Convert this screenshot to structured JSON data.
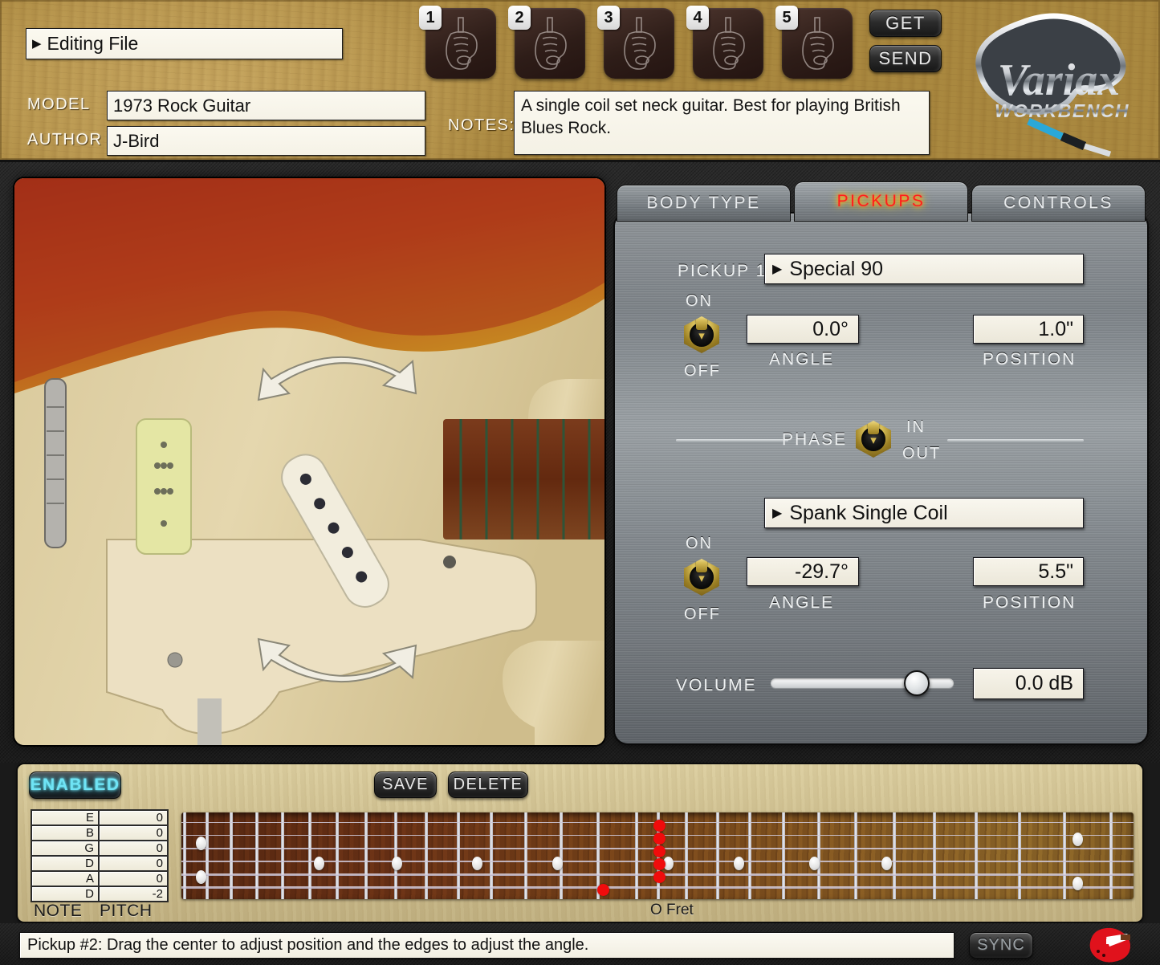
{
  "header": {
    "file_select": "Editing File",
    "model_label": "MODEL",
    "model_value": "1973 Rock Guitar",
    "author_label": "AUTHOR",
    "author_value": "J-Bird",
    "notes_label": "NOTES:",
    "notes_value": "A single coil set neck guitar.  Best for playing British Blues Rock.",
    "get_label": "GET",
    "send_label": "SEND",
    "presets": [
      "1",
      "2",
      "3",
      "4",
      "5"
    ],
    "logo_name": "Variax",
    "logo_sub": "WORKBENCH"
  },
  "tabs": [
    {
      "label": "BODY TYPE",
      "active": false
    },
    {
      "label": "PICKUPS",
      "active": true
    },
    {
      "label": "CONTROLS",
      "active": false
    }
  ],
  "pickups_panel": {
    "pickup1": {
      "row_label": "PICKUP 1",
      "model": "Special 90",
      "toggle_on": "ON",
      "toggle_off": "OFF",
      "angle_value": "0.0°",
      "angle_label": "ANGLE",
      "position_value": "1.0\"",
      "position_label": "POSITION"
    },
    "phase": {
      "label": "PHASE",
      "in_label": "IN",
      "out_label": "OUT"
    },
    "pickup2": {
      "model": "Spank Single Coil",
      "toggle_on": "ON",
      "toggle_off": "OFF",
      "angle_value": "-29.7°",
      "angle_label": "ANGLE",
      "position_value": "5.5\"",
      "position_label": "POSITION"
    },
    "volume": {
      "label": "VOLUME",
      "value": "0.0 dB",
      "knob_percent": 80
    }
  },
  "bottom": {
    "enabled_label": "ENABLED",
    "save_label": "SAVE",
    "delete_label": "DELETE",
    "note_header": "NOTE",
    "pitch_header": "PITCH",
    "tuning_rows": [
      {
        "note": "E",
        "pitch": "0"
      },
      {
        "note": "B",
        "pitch": "0"
      },
      {
        "note": "G",
        "pitch": "0"
      },
      {
        "note": "D",
        "pitch": "0"
      },
      {
        "note": "A",
        "pitch": "0"
      },
      {
        "note": "D",
        "pitch": "-2"
      }
    ],
    "zero_fret_label": "O Fret"
  },
  "status": {
    "message": "Pickup #2: Drag the center to adjust position and the edges to adjust the angle.",
    "sync_label": "SYNC"
  },
  "colors": {
    "accent_red": "#ff1d1d",
    "accent_cyan": "#6fe4f5",
    "wood": "#c4a35c",
    "panel_metal": "#8e9397",
    "marker_red": "#f00c0c"
  }
}
